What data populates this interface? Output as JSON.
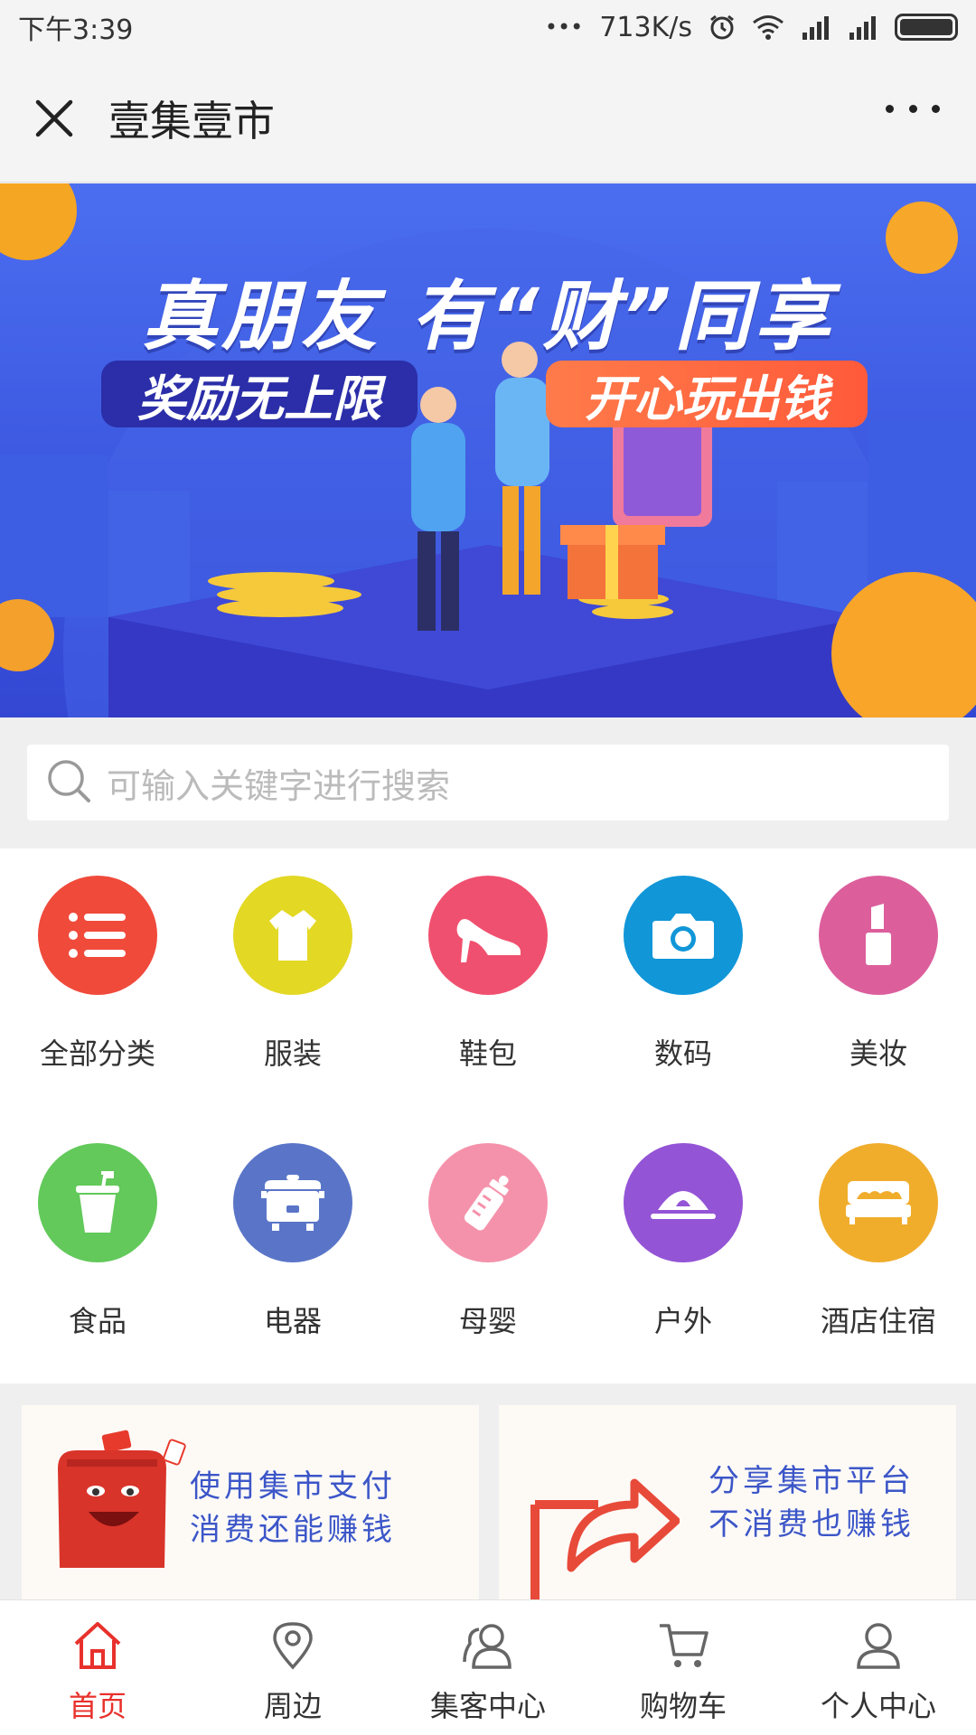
{
  "status_bar": {
    "time": "下午3:39",
    "dots": "•••",
    "speed": "713K/s"
  },
  "header": {
    "title": "壹集壹市"
  },
  "banner": {
    "headline": "真朋友 有“财”同享",
    "pill_left": "奖励无上限",
    "pill_right": "开心玩出钱"
  },
  "search": {
    "placeholder": "可输入关键字进行搜索"
  },
  "categories": [
    {
      "label": "全部分类",
      "icon": "list-icon",
      "color": "#f04a3b"
    },
    {
      "label": "服装",
      "icon": "shirt-icon",
      "color": "#e3d824"
    },
    {
      "label": "鞋包",
      "icon": "high-heel-icon",
      "color": "#f0506f"
    },
    {
      "label": "数码",
      "icon": "camera-icon",
      "color": "#1196d8"
    },
    {
      "label": "美妆",
      "icon": "lipstick-icon",
      "color": "#dc5f9c"
    },
    {
      "label": "食品",
      "icon": "drink-cup-icon",
      "color": "#62c95a"
    },
    {
      "label": "电器",
      "icon": "rice-cooker-icon",
      "color": "#5a75c8"
    },
    {
      "label": "母婴",
      "icon": "baby-bottle-icon",
      "color": "#f592ab"
    },
    {
      "label": "户外",
      "icon": "tent-icon",
      "color": "#9454d6"
    },
    {
      "label": "酒店住宿",
      "icon": "bed-icon",
      "color": "#f0ad2c"
    }
  ],
  "promos": [
    {
      "line1": "使用集市支付",
      "line2": "消费还能赚钱"
    },
    {
      "line1": "分享集市平台",
      "line2": "不消费也赚钱"
    }
  ],
  "tabs": [
    {
      "label": "首页",
      "icon": "home-icon",
      "active": true
    },
    {
      "label": "周边",
      "icon": "location-pin-icon",
      "active": false
    },
    {
      "label": "集客中心",
      "icon": "users-icon",
      "active": false
    },
    {
      "label": "购物车",
      "icon": "cart-icon",
      "active": false
    },
    {
      "label": "个人中心",
      "icon": "person-icon",
      "active": false
    }
  ],
  "colors": {
    "accent": "#e8312c",
    "banner_blue": "#3c58e0",
    "promo_text": "#3c56c8"
  }
}
